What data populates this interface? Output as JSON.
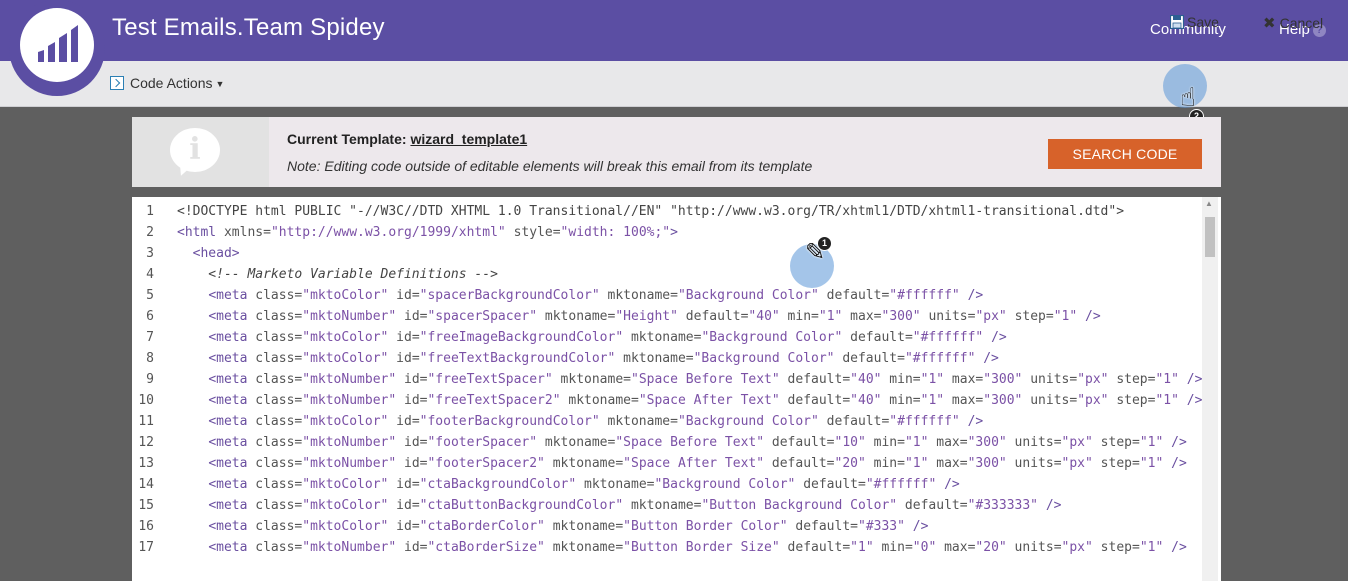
{
  "header": {
    "title": "Test Emails.Team Spidey",
    "community": "Community",
    "help": "Help",
    "help_icon": "?"
  },
  "toolbar": {
    "code_actions": "Code Actions",
    "save": "Save",
    "cancel": "Cancel"
  },
  "info": {
    "template_label": "Current Template:",
    "template_name": "wizard_template1",
    "note": "Note: Editing code outside of editable elements will break this email from its template",
    "search_button": "SEARCH CODE"
  },
  "annotations": {
    "step1": "1",
    "step2": "2"
  },
  "editor": {
    "lines": [
      {
        "n": "1",
        "text": "<!DOCTYPE html PUBLIC \"-//W3C//DTD XHTML 1.0 Transitional//EN\" \"http://www.w3.org/TR/xhtml1/DTD/xhtml1-transitional.dtd\">"
      },
      {
        "n": "2",
        "text": "<html xmlns=\"http://www.w3.org/1999/xhtml\" style=\"width: 100%;\">"
      },
      {
        "n": "3",
        "text": "  <head>"
      },
      {
        "n": "4",
        "text": "    <!-- Marketo Variable Definitions -->"
      },
      {
        "n": "5",
        "text": "    <meta class=\"mktoColor\" id=\"spacerBackgroundColor\" mktoname=\"Background Color\" default=\"#ffffff\" />"
      },
      {
        "n": "6",
        "text": "    <meta class=\"mktoNumber\" id=\"spacerSpacer\" mktoname=\"Height\" default=\"40\" min=\"1\" max=\"300\" units=\"px\" step=\"1\" />"
      },
      {
        "n": "7",
        "text": "    <meta class=\"mktoColor\" id=\"freeImageBackgroundColor\" mktoname=\"Background Color\" default=\"#ffffff\" />"
      },
      {
        "n": "8",
        "text": "    <meta class=\"mktoColor\" id=\"freeTextBackgroundColor\" mktoname=\"Background Color\" default=\"#ffffff\" />"
      },
      {
        "n": "9",
        "text": "    <meta class=\"mktoNumber\" id=\"freeTextSpacer\" mktoname=\"Space Before Text\" default=\"40\" min=\"1\" max=\"300\" units=\"px\" step=\"1\" />"
      },
      {
        "n": "10",
        "text": "    <meta class=\"mktoNumber\" id=\"freeTextSpacer2\" mktoname=\"Space After Text\" default=\"40\" min=\"1\" max=\"300\" units=\"px\" step=\"1\" />"
      },
      {
        "n": "11",
        "text": "    <meta class=\"mktoColor\" id=\"footerBackgroundColor\" mktoname=\"Background Color\" default=\"#ffffff\" />"
      },
      {
        "n": "12",
        "text": "    <meta class=\"mktoNumber\" id=\"footerSpacer\" mktoname=\"Space Before Text\" default=\"10\" min=\"1\" max=\"300\" units=\"px\" step=\"1\" />"
      },
      {
        "n": "13",
        "text": "    <meta class=\"mktoNumber\" id=\"footerSpacer2\" mktoname=\"Space After Text\" default=\"20\" min=\"1\" max=\"300\" units=\"px\" step=\"1\" />"
      },
      {
        "n": "14",
        "text": "    <meta class=\"mktoColor\" id=\"ctaBackgroundColor\" mktoname=\"Background Color\" default=\"#ffffff\" />"
      },
      {
        "n": "15",
        "text": "    <meta class=\"mktoColor\" id=\"ctaButtonBackgroundColor\" mktoname=\"Button Background Color\" default=\"#333333\" />"
      },
      {
        "n": "16",
        "text": "    <meta class=\"mktoColor\" id=\"ctaBorderColor\" mktoname=\"Button Border Color\" default=\"#333\" />"
      },
      {
        "n": "17",
        "text": "    <meta class=\"mktoNumber\" id=\"ctaBorderSize\" mktoname=\"Button Border Size\" default=\"1\" min=\"0\" max=\"20\" units=\"px\" step=\"1\" />"
      }
    ]
  },
  "colors": {
    "header_bg": "#5b4ea3",
    "accent_orange": "#d7622a",
    "workspace_bg": "#5f5f5f"
  }
}
